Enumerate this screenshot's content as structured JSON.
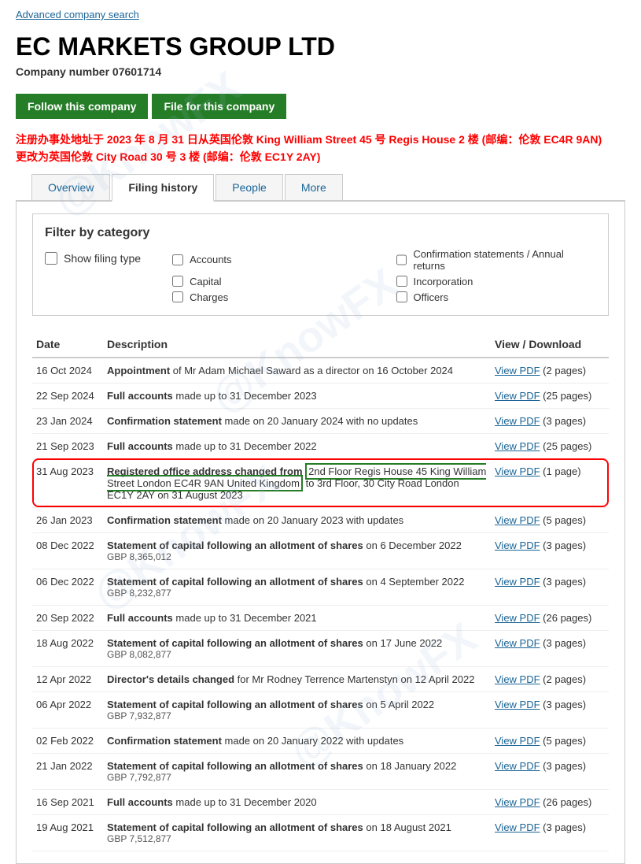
{
  "header": {
    "advanced_search_link": "Advanced company search",
    "company_name": "EC MARKETS GROUP LTD",
    "company_number_label": "Company number",
    "company_number": "07601714"
  },
  "buttons": {
    "follow": "Follow this company",
    "file": "File for this company"
  },
  "notice": {
    "line1": "注册办事处地址于 2023 年 8 月 31 日从英国伦敦 King William Street 45 号 Regis House 2 楼 (邮编：伦敦 EC4R 9AN)",
    "line2": "更改为英国伦敦 City Road 30 号 3 楼 (邮编：伦敦 EC1Y 2AY)"
  },
  "tabs": [
    {
      "label": "Overview",
      "active": false
    },
    {
      "label": "Filing history",
      "active": true
    },
    {
      "label": "People",
      "active": false
    },
    {
      "label": "More",
      "active": false
    }
  ],
  "filter": {
    "title": "Filter by category",
    "show_label": "Show filing type",
    "categories": [
      "Accounts",
      "Confirmation statements / Annual returns",
      "Capital",
      "Incorporation",
      "Charges",
      "Officers"
    ]
  },
  "table": {
    "headers": [
      "Date",
      "Description",
      "View / Download"
    ],
    "rows": [
      {
        "date": "16 Oct 2024",
        "desc_bold": "Appointment",
        "desc_rest": " of Mr Adam Michael Saward as a director on 16 October 2024",
        "sub": "",
        "view": "View PDF",
        "pages": "(2 pages)",
        "highlighted": false
      },
      {
        "date": "22 Sep 2024",
        "desc_bold": "Full accounts",
        "desc_rest": " made up to 31 December 2023",
        "sub": "",
        "view": "View PDF",
        "pages": "(25 pages)",
        "highlighted": false
      },
      {
        "date": "23 Jan 2024",
        "desc_bold": "Confirmation statement",
        "desc_rest": " made on 20 January 2024 with no updates",
        "sub": "",
        "view": "View PDF",
        "pages": "(3 pages)",
        "highlighted": false
      },
      {
        "date": "21 Sep 2023",
        "desc_bold": "Full accounts",
        "desc_rest": " made up to 31 December 2022",
        "sub": "",
        "view": "View PDF",
        "pages": "(25 pages)",
        "highlighted": false
      },
      {
        "date": "31 Aug 2023",
        "desc_bold": "Registered office address changed from",
        "desc_highlight": " 2nd Floor Regis House 45 King William Street London EC4R 9AN United Kingdom",
        "desc_rest": " to 3rd Floor, 30 City Road London EC1Y 2AY on 31 August 2023",
        "sub": "",
        "view": "View PDF",
        "pages": "(1 page)",
        "highlighted": true
      },
      {
        "date": "26 Jan 2023",
        "desc_bold": "Confirmation statement",
        "desc_rest": " made on 20 January 2023 with updates",
        "sub": "",
        "view": "View PDF",
        "pages": "(5 pages)",
        "highlighted": false
      },
      {
        "date": "08 Dec 2022",
        "desc_bold": "Statement of capital following an allotment of shares",
        "desc_rest": " on 6 December 2022",
        "sub": "GBP 8,365,012",
        "view": "View PDF",
        "pages": "(3 pages)",
        "highlighted": false
      },
      {
        "date": "06 Dec 2022",
        "desc_bold": "Statement of capital following an allotment of shares",
        "desc_rest": " on 4 September 2022",
        "sub": "GBP 8,232,877",
        "view": "View PDF",
        "pages": "(3 pages)",
        "highlighted": false
      },
      {
        "date": "20 Sep 2022",
        "desc_bold": "Full accounts",
        "desc_rest": " made up to 31 December 2021",
        "sub": "",
        "view": "View PDF",
        "pages": "(26 pages)",
        "highlighted": false
      },
      {
        "date": "18 Aug 2022",
        "desc_bold": "Statement of capital following an allotment of shares",
        "desc_rest": " on 17 June 2022",
        "sub": "GBP 8,082,877",
        "view": "View PDF",
        "pages": "(3 pages)",
        "highlighted": false
      },
      {
        "date": "12 Apr 2022",
        "desc_bold": "Director's details changed",
        "desc_rest": " for Mr Rodney Terrence Martenstyn on 12 April 2022",
        "sub": "",
        "view": "View PDF",
        "pages": "(2 pages)",
        "highlighted": false
      },
      {
        "date": "06 Apr 2022",
        "desc_bold": "Statement of capital following an allotment of shares",
        "desc_rest": " on 5 April 2022",
        "sub": "GBP 7,932,877",
        "view": "View PDF",
        "pages": "(3 pages)",
        "highlighted": false
      },
      {
        "date": "02 Feb 2022",
        "desc_bold": "Confirmation statement",
        "desc_rest": " made on 20 January 2022 with updates",
        "sub": "",
        "view": "View PDF",
        "pages": "(5 pages)",
        "highlighted": false
      },
      {
        "date": "21 Jan 2022",
        "desc_bold": "Statement of capital following an allotment of shares",
        "desc_rest": " on 18 January 2022",
        "sub": "GBP 7,792,877",
        "view": "View PDF",
        "pages": "(3 pages)",
        "highlighted": false
      },
      {
        "date": "16 Sep 2021",
        "desc_bold": "Full accounts",
        "desc_rest": " made up to 31 December 2020",
        "sub": "",
        "view": "View PDF",
        "pages": "(26 pages)",
        "highlighted": false
      },
      {
        "date": "19 Aug 2021",
        "desc_bold": "Statement of capital following an allotment of shares",
        "desc_rest": " on 18 August 2021",
        "sub": "GBP 7,512,877",
        "view": "View PDF",
        "pages": "(3 pages)",
        "highlighted": false
      }
    ]
  },
  "colors": {
    "green_btn": "#267d27",
    "link_blue": "#1a6496",
    "red_notice": "#cc0000"
  }
}
